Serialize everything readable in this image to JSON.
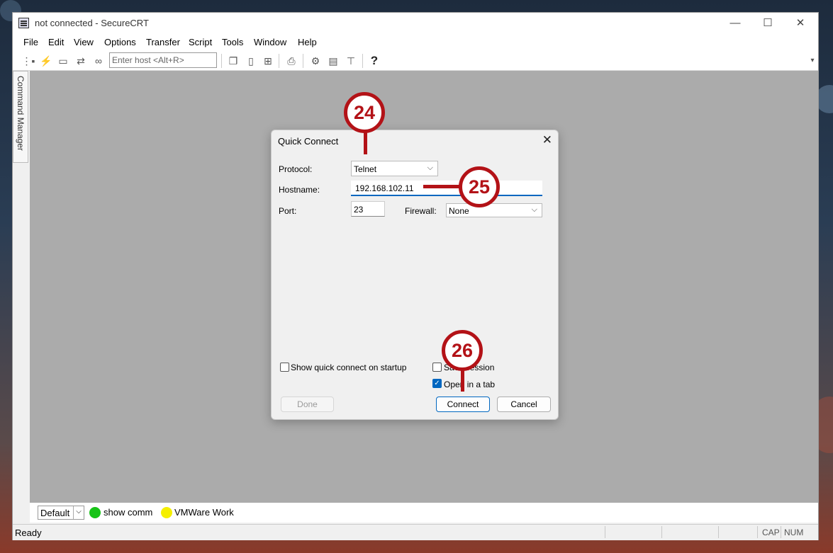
{
  "window": {
    "title": "not connected - SecureCRT",
    "controls": {
      "minimize": "—",
      "maximize": "☐",
      "close": "✕"
    }
  },
  "menu": [
    "File",
    "Edit",
    "View",
    "Options",
    "Transfer",
    "Script",
    "Tools",
    "Window",
    "Help"
  ],
  "toolbar": {
    "host_placeholder": "Enter host <Alt+R>",
    "help_icon": "?",
    "overflow": "▾"
  },
  "sidebar": {
    "command_manager": "Command Manager"
  },
  "dialog": {
    "title": "Quick Connect",
    "close": "✕",
    "protocol_label": "Protocol:",
    "protocol_value": "Telnet",
    "hostname_label": "Hostname:",
    "hostname_value": "192.168.102.11",
    "port_label": "Port:",
    "port_value": "23",
    "firewall_label": "Firewall:",
    "firewall_value": "None",
    "show_quick_connect": "Show quick connect on startup",
    "save_session": "Save session",
    "open_in_tab": "Open in a tab",
    "done": "Done",
    "connect": "Connect",
    "cancel": "Cancel",
    "chevron": "⌵"
  },
  "button_bar": {
    "default_value": "Default",
    "chevron": "⌵",
    "items": [
      {
        "label": "show comm",
        "color": "#17c317"
      },
      {
        "label": "VMWare Work",
        "color": "#f5ef00"
      }
    ]
  },
  "status": {
    "text": "Ready",
    "cap": "CAP",
    "num": "NUM"
  },
  "annotations": [
    {
      "label": "24",
      "color": "#b31217"
    },
    {
      "label": "25",
      "color": "#b31217"
    },
    {
      "label": "26",
      "color": "#b31217"
    }
  ]
}
